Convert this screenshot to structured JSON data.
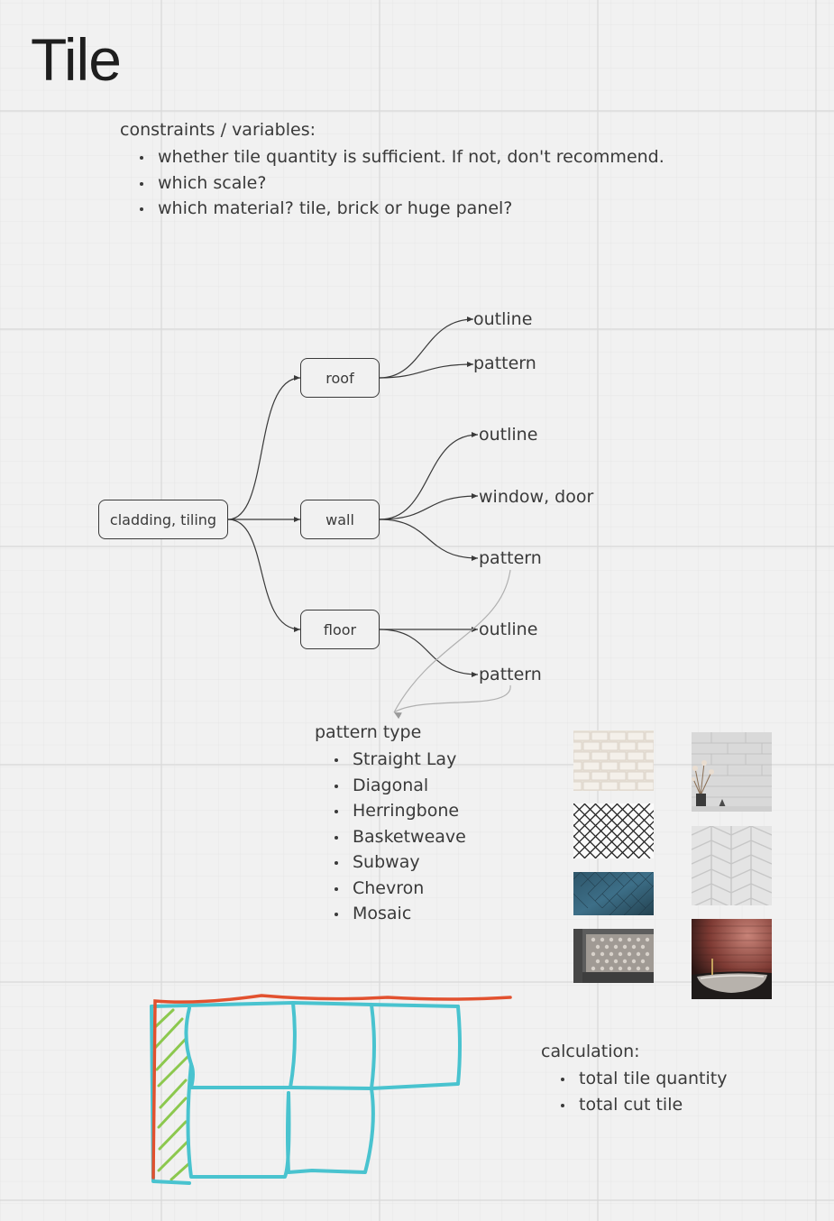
{
  "board": {
    "title": "Tile",
    "grid_color": "#dcdcdc",
    "accent_colors": {
      "sketch_red": "#e2512f",
      "sketch_cyan": "#49c3cf",
      "sketch_green": "#8cc84e"
    }
  },
  "constraints": {
    "heading": "constraints / variables:",
    "items": [
      "whether tile quantity is sufficient. If not, don't recommend.",
      "which scale?",
      "which material? tile, brick or huge panel?"
    ]
  },
  "mindmap": {
    "root": "cladding, tiling",
    "branches": [
      {
        "label": "roof",
        "children": [
          "outline",
          "pattern"
        ]
      },
      {
        "label": "wall",
        "children": [
          "outline",
          "window, door",
          "pattern"
        ]
      },
      {
        "label": "floor",
        "children": [
          "outline",
          "pattern"
        ]
      }
    ]
  },
  "pattern_types": {
    "heading": "pattern type",
    "items": [
      "Straight Lay",
      "Diagonal",
      "Herringbone",
      "Basketweave",
      "Subway",
      "Chevron",
      "Mosaic"
    ]
  },
  "calculation": {
    "heading": "calculation:",
    "items": [
      "total tile quantity",
      "total cut tile"
    ]
  },
  "reference_images": [
    "beige-tile-photo",
    "white-subway-wall-photo",
    "diagonal-lattice-photo",
    "white-chevron-photo",
    "blue-herringbone-photo",
    "mosaic-floor-photo",
    "red-brick-bathroom-photo"
  ]
}
